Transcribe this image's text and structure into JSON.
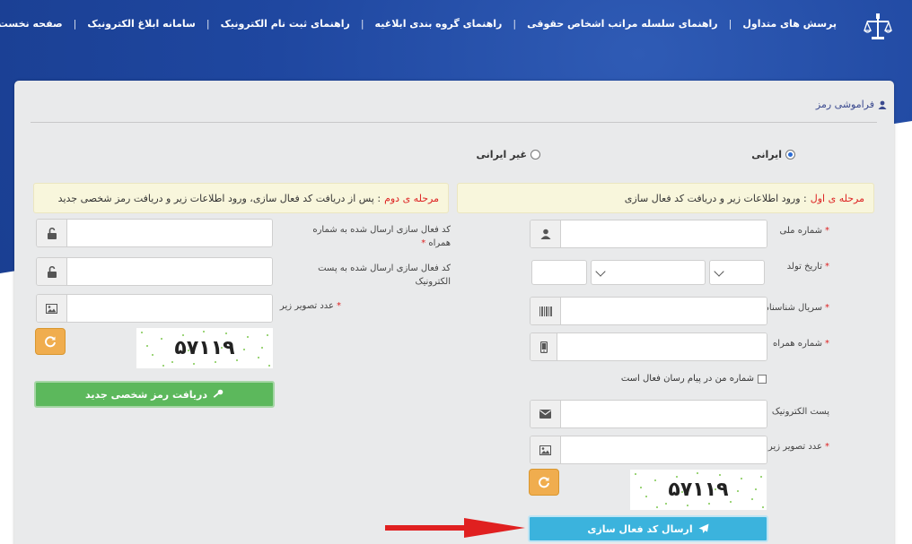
{
  "nav": {
    "items": [
      "صفحه نخست",
      "سامانه ابلاغ الکترونیک",
      "راهنمای ثبت نام الکترونیک",
      "راهنمای گروه بندی ابلاغیه",
      "راهنمای سلسله مراتب اشخاص حقوقی",
      "پرسش های متداول"
    ],
    "separator": "|"
  },
  "card": {
    "title": "فراموشی رمز"
  },
  "nationality": {
    "iranian": "ایرانی",
    "non_iranian": "غیر ایرانی",
    "selected": "ایرانی"
  },
  "stage1": {
    "title": "مرحله ی اول",
    "text": ": ورود اطلاعات زیر و دریافت کد فعال سازی",
    "national_id_label": "شماره ملی",
    "birth_date_label": "تاریخ تولد",
    "serial_label": "سریال شناسنامه",
    "mobile_label": "شماره همراه",
    "messenger_label": "شماره من در پیام رسان فعال است",
    "email_label": "پست الکترونیک",
    "captcha_label": "عدد تصویر زیر",
    "captcha_value": "۵۷۱۱۹",
    "submit_label": "ارسال کد فعال سازی"
  },
  "stage2": {
    "title": "مرحله ی دوم",
    "text": ": پس از دریافت کد فعال سازی، ورود اطلاعات زیر و دریافت رمز شخصی جدید",
    "mobile_code_label": "کد فعال سازی ارسال شده به شماره همراه",
    "email_code_label": "کد فعال سازی ارسال شده به پست الکترونیک",
    "captcha_label": "عدد تصویر زیر",
    "captcha_value": "۵۷۱۱۹",
    "submit_label": "دریافت رمز شخصی جدید"
  },
  "required_mark": "*",
  "colors": {
    "header_blue": "#1f47a0",
    "required_red": "#dd2222",
    "stage_bg": "#f8f6dc",
    "green": "#5cb85c",
    "blue": "#3bb3dd",
    "orange": "#f0ad4e",
    "arrow_red": "#e02020"
  }
}
